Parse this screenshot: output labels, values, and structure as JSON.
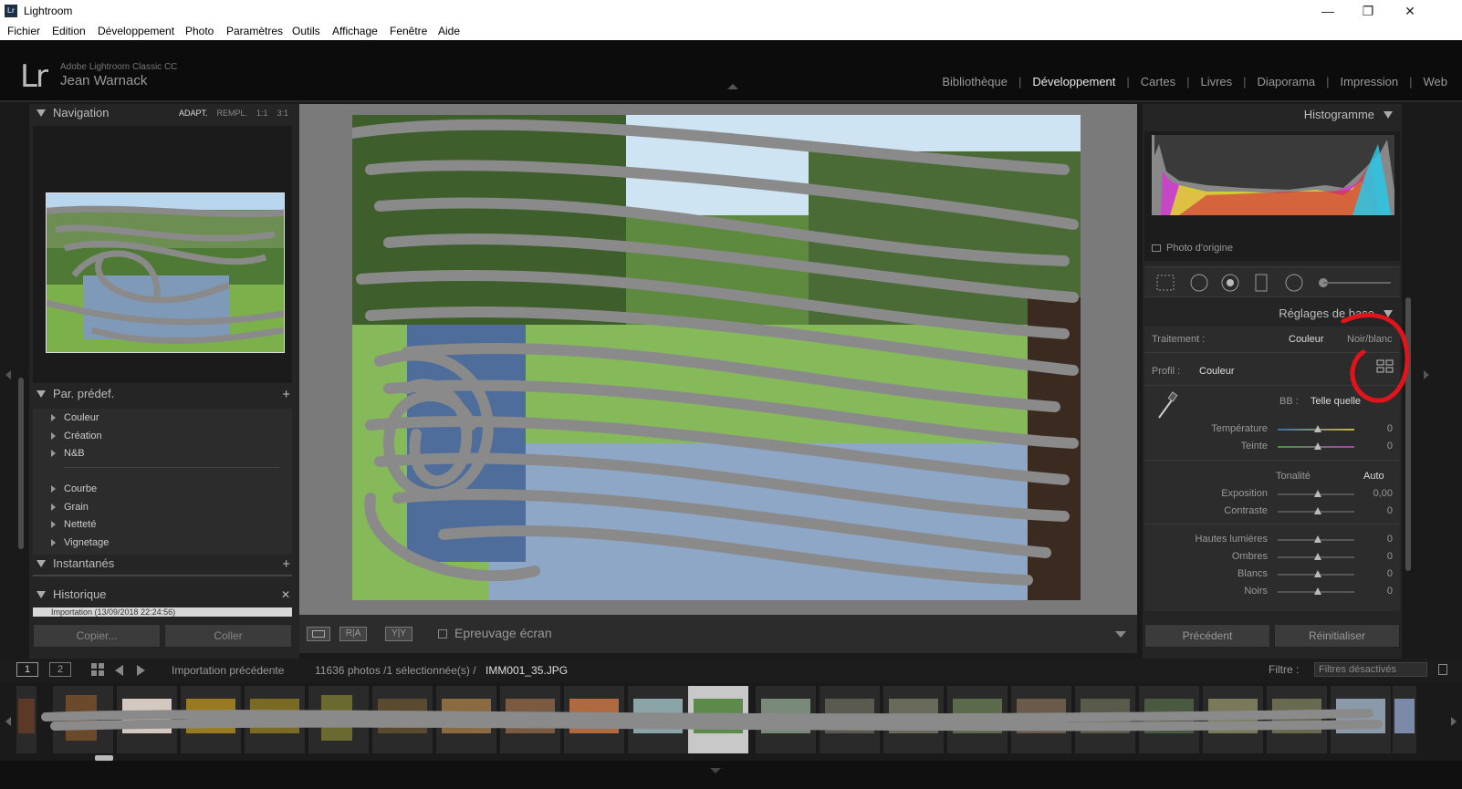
{
  "window": {
    "title": "Lightroom",
    "logo": "Lr",
    "minimize_glyph": "—",
    "maximize_glyph": "❐",
    "close_glyph": "✕"
  },
  "menu": [
    "Fichier",
    "Edition",
    "Développement",
    "Photo",
    "Paramètres",
    "Outils",
    "Affichage",
    "Fenêtre",
    "Aide"
  ],
  "identity": {
    "logo": "Lr",
    "product": "Adobe Lightroom Classic CC",
    "user": "Jean Warnack"
  },
  "modules": {
    "library": "Bibliothèque",
    "develop": "Développement",
    "map": "Cartes",
    "book": "Livres",
    "slideshow": "Diaporama",
    "print": "Impression",
    "web": "Web",
    "separator": "|",
    "active": "develop"
  },
  "left": {
    "navigation": {
      "title": "Navigation",
      "options": [
        "ADAPT.",
        "REMPL.",
        "1:1",
        "3:1"
      ],
      "active_option": "ADAPT."
    },
    "presets": {
      "title": "Par. prédef.",
      "add": "+",
      "group1": [
        "Couleur",
        "Création",
        "N&B"
      ],
      "group2": [
        "Courbe",
        "Grain",
        "Netteté",
        "Vignetage"
      ]
    },
    "snapshots": {
      "title": "Instantanés",
      "add": "+"
    },
    "history": {
      "title": "Historique",
      "close": "✕",
      "first_item": "Importation (13/09/2018 22:24:56)"
    },
    "buttons": {
      "copy": "Copier...",
      "paste": "Coller"
    }
  },
  "toolbar": {
    "view_ab": "R|A",
    "view_yy": "Y|Y",
    "proofing": "Epreuvage écran"
  },
  "right": {
    "histogram": {
      "title": "Histogramme",
      "original_photo": "Photo d'origine"
    },
    "basic": {
      "title": "Réglages de base",
      "treatment_label": "Traitement :",
      "treatment_color": "Couleur",
      "treatment_bw": "Noir/blanc",
      "profile_label": "Profil :",
      "profile_value": "Couleur",
      "wb_label": "BB :",
      "wb_value": "Telle quelle",
      "tone_label": "Tonalité",
      "auto": "Auto",
      "sliders": [
        {
          "label": "Température",
          "value": "0"
        },
        {
          "label": "Teinte",
          "value": "0"
        },
        {
          "label": "Exposition",
          "value": "0,00"
        },
        {
          "label": "Contraste",
          "value": "0"
        },
        {
          "label": "Hautes lumières",
          "value": "0"
        },
        {
          "label": "Ombres",
          "value": "0"
        },
        {
          "label": "Blancs",
          "value": "0"
        },
        {
          "label": "Noirs",
          "value": "0"
        }
      ]
    },
    "buttons": {
      "previous": "Précédent",
      "reset": "Réinitialiser"
    }
  },
  "filmbar": {
    "screen1": "1",
    "screen2": "2",
    "source": "Importation précédente",
    "count": "11636 photos /1 sélectionnée(s) /",
    "filename": "IMM001_35.JPG",
    "filter_label": "Filtre :",
    "filter_value": "Filtres désactivés"
  },
  "colors": {
    "annotation_red": "#e0141a",
    "scribble_gray": "#8a8a8a",
    "panel_bg": "#252525",
    "active_text": "#e8e8e8"
  }
}
